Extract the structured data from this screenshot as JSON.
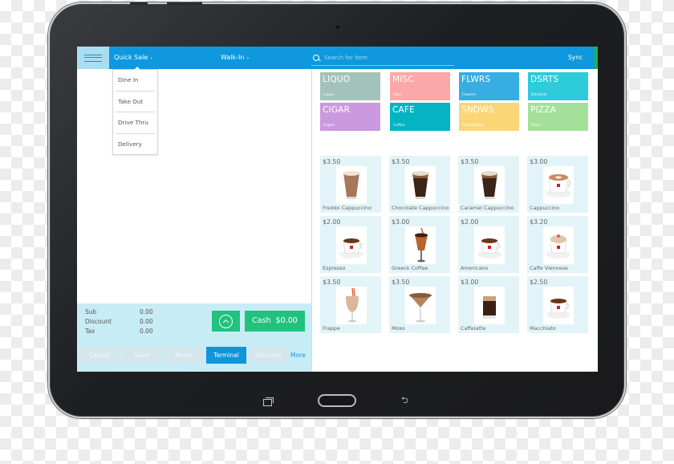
{
  "device": {
    "nav_buttons": [
      "recent-apps",
      "home",
      "back"
    ],
    "back_glyph": "⮌"
  },
  "header": {
    "menu_icon": "hamburger-icon",
    "order_type_label": "Quick Sale",
    "customer_label": "Walk-In",
    "search_placeholder": "Search for item",
    "sync_label": "Sync"
  },
  "order_type_dropdown": {
    "items": [
      "Dine In",
      "Take Out",
      "Drive Thru",
      "Delivery"
    ]
  },
  "totals": {
    "rows": [
      {
        "label": "Sub",
        "value": "0.00"
      },
      {
        "label": "Discount",
        "value": "0.00"
      },
      {
        "label": "Tax",
        "value": "0.00"
      }
    ],
    "cash_label": "Cash",
    "cash_amount": "$0.00"
  },
  "actions": {
    "buttons": [
      {
        "label": "Cancel",
        "active": false
      },
      {
        "label": "Save",
        "active": false
      },
      {
        "label": "Notes",
        "active": false
      },
      {
        "label": "Terminal",
        "active": true
      },
      {
        "label": "Discount",
        "active": false
      }
    ],
    "more_label": "More"
  },
  "categories": [
    {
      "code": "LIQUO",
      "name": "Liquor",
      "color": "#a3c3ba"
    },
    {
      "code": "MISC",
      "name": "Misc",
      "color": "#fda8a8"
    },
    {
      "code": "FLWRS",
      "name": "Flowers",
      "color": "#38ade2"
    },
    {
      "code": "DSRTS",
      "name": "Desserts",
      "color": "#2ecbdb"
    },
    {
      "code": "CIGAR",
      "name": "Cigars",
      "color": "#cb99df"
    },
    {
      "code": "CAFE",
      "name": "Coffee",
      "color": "#04b4c2"
    },
    {
      "code": "SNDWS",
      "name": "Sandwiches",
      "color": "#fad677"
    },
    {
      "code": "PIZZA",
      "name": "Pizza",
      "color": "#a5e09a"
    }
  ],
  "products": [
    {
      "price": "$3.50",
      "name": "Freddo Cappuccino",
      "image": "glass-cappuccino"
    },
    {
      "price": "$3.50",
      "name": "Chocolate Cappuccino",
      "image": "glass-dark"
    },
    {
      "price": "$3.50",
      "name": "Caramel Cappuccino",
      "image": "glass-dark"
    },
    {
      "price": "$3.00",
      "name": "Cappuccino",
      "image": "cup-latte"
    },
    {
      "price": "$2.00",
      "name": "Espresso",
      "image": "cup-espresso"
    },
    {
      "price": "$3.00",
      "name": "Greeck Coffee",
      "image": "glass-straw"
    },
    {
      "price": "$2.00",
      "name": "Americano",
      "image": "cup-espresso"
    },
    {
      "price": "$3.20",
      "name": "Caffe Viennese",
      "image": "cup-cream"
    },
    {
      "price": "$3.50",
      "name": "Frappe",
      "image": "glass-frappe"
    },
    {
      "price": "$3.50",
      "name": "Moko",
      "image": "glass-martini"
    },
    {
      "price": "$3.00",
      "name": "Caffelatte",
      "image": "glass-shot"
    },
    {
      "price": "$2.50",
      "name": "Macchiato",
      "image": "cup-espresso"
    }
  ],
  "colors": {
    "header_blue": "#0f98dd",
    "accent_green": "#20c27e",
    "terminal_blue": "#0f95d8",
    "totals_bg": "#c8ecf5",
    "product_bg": "#e3f4f8"
  }
}
